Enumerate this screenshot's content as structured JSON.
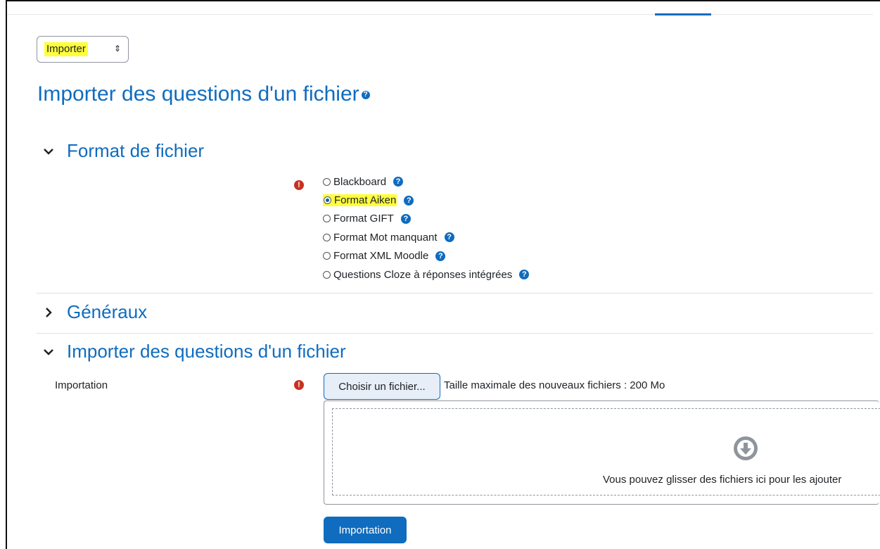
{
  "action_select": {
    "selected": "Importer"
  },
  "page": {
    "title": "Importer des questions d'un fichier"
  },
  "sections": {
    "format": {
      "title": "Format de fichier",
      "options": [
        {
          "label": "Blackboard",
          "checked": false,
          "highlight": false
        },
        {
          "label": "Format Aiken",
          "checked": true,
          "highlight": true
        },
        {
          "label": "Format GIFT",
          "checked": false,
          "highlight": false
        },
        {
          "label": "Format Mot manquant",
          "checked": false,
          "highlight": false
        },
        {
          "label": "Format XML Moodle",
          "checked": false,
          "highlight": false
        },
        {
          "label": "Questions Cloze à réponses intégrées",
          "checked": false,
          "highlight": false
        }
      ]
    },
    "general": {
      "title": "Généraux"
    },
    "import_file": {
      "title": "Importer des questions d'un fichier",
      "field_label": "Importation",
      "choose_button": "Choisir un fichier...",
      "max_size": "Taille maximale des nouveaux fichiers : 200 Mo",
      "drop_text": "Vous pouvez glisser des fichiers ici pour les ajouter"
    }
  },
  "submit": {
    "label": "Importation"
  },
  "colors": {
    "accent": "#0f6cbf",
    "highlight": "#ffff3b",
    "required": "#ca3120"
  }
}
